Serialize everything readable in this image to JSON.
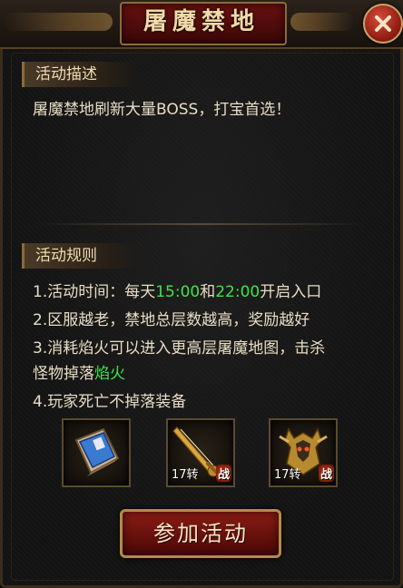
{
  "window": {
    "title": "屠魔禁地"
  },
  "description": {
    "tab_label": "活动描述",
    "text": "屠魔禁地刷新大量BOSS，打宝首选！"
  },
  "rules": {
    "tab_label": "活动规则",
    "line1_prefix": "1.活动时间：每天",
    "line1_time1": "15:00",
    "line1_mid": "和",
    "line1_time2": "22:00",
    "line1_suffix": "开启入口",
    "line2": "2.区服越老，禁地总层数越高，奖励越好",
    "line3a": "3.消耗焰火可以进入更高层屠魔地图，击杀",
    "line3b_prefix": "怪物掉落",
    "line3b_highlight": "焰火",
    "line4": "4.玩家死亡不掉落装备"
  },
  "rewards": [
    {
      "icon": "scroll-icon",
      "level": "",
      "badge": ""
    },
    {
      "icon": "sword-icon",
      "level": "17转",
      "badge": "战"
    },
    {
      "icon": "armor-icon",
      "level": "17转",
      "badge": "战"
    }
  ],
  "join_button": {
    "label": "参加活动"
  },
  "colors": {
    "highlight_green": "#41e34a",
    "title_red": "#6a1010",
    "text": "#e8dcc4"
  }
}
